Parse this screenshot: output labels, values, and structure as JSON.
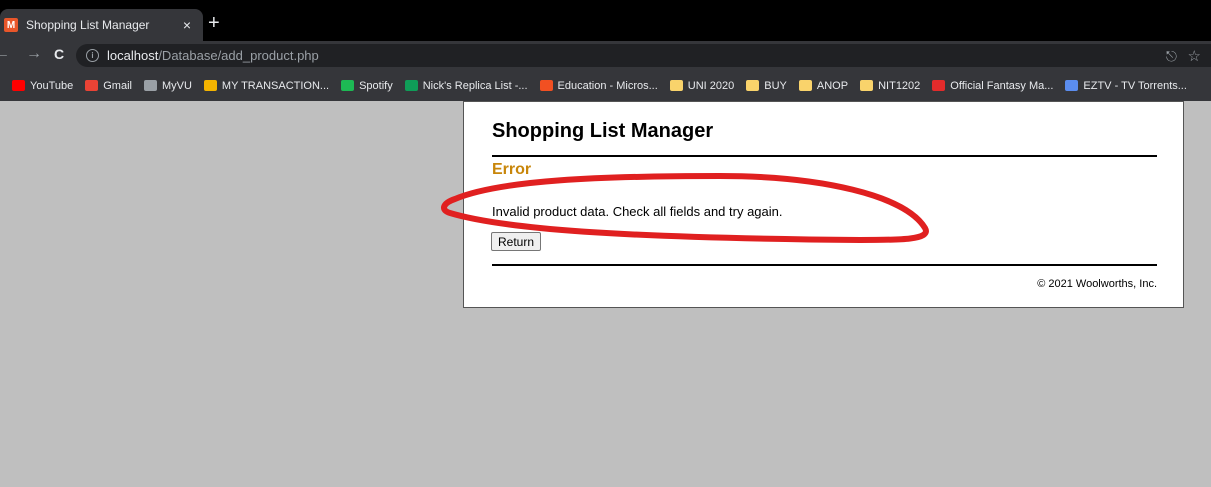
{
  "browser": {
    "tab": {
      "title": "Shopping List Manager",
      "close": "×",
      "favicon_letter": "M"
    },
    "new_tab": "+",
    "nav": {
      "back": "←",
      "forward": "→",
      "reload": "C"
    },
    "address": {
      "host": "localhost",
      "path": "/Database/add_product.php",
      "info": "i"
    },
    "share": "⎋",
    "star": "☆",
    "bookmarks": [
      {
        "label": "YouTube",
        "color": "#ff0000"
      },
      {
        "label": "Gmail",
        "color": "#ea4335"
      },
      {
        "label": "MyVU",
        "color": "#9aa0a6"
      },
      {
        "label": "MY TRANSACTION...",
        "color": "#f4b400"
      },
      {
        "label": "Spotify",
        "color": "#1db954"
      },
      {
        "label": "Nick's Replica List -...",
        "color": "#0f9d58"
      },
      {
        "label": "Education - Micros...",
        "color": "#f25022"
      },
      {
        "label": "UNI 2020",
        "color": "#f9d36b"
      },
      {
        "label": "BUY",
        "color": "#f9d36b"
      },
      {
        "label": "ANOP",
        "color": "#f9d36b"
      },
      {
        "label": "NIT1202",
        "color": "#f9d36b"
      },
      {
        "label": "Official Fantasy Ma...",
        "color": "#e32b2b"
      },
      {
        "label": "EZTV - TV Torrents...",
        "color": "#5b8def"
      }
    ]
  },
  "page": {
    "title": "Shopping List Manager",
    "error_heading": "Error",
    "message": "Invalid product data. Check all fields and try again.",
    "return_label": "Return",
    "footer": "© 2021 Woolworths, Inc."
  },
  "colors": {
    "error": "#c8860a",
    "annotation": "#e02020"
  }
}
